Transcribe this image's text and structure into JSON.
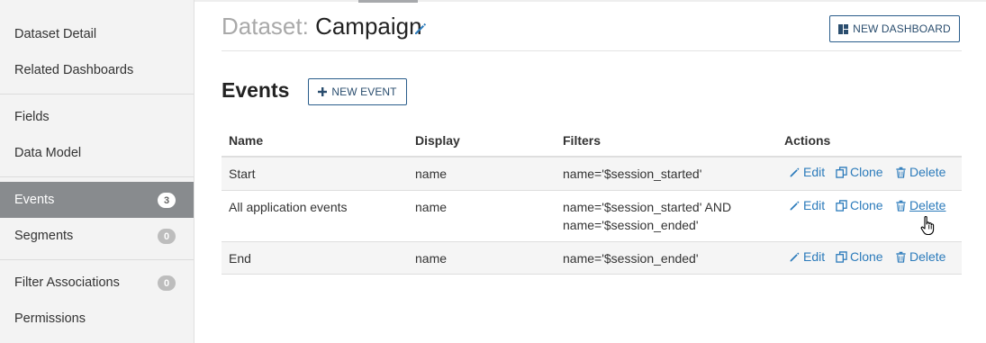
{
  "sidebar": {
    "items": [
      {
        "label": "Dataset Detail"
      },
      {
        "label": "Related Dashboards"
      },
      {
        "label": "Fields"
      },
      {
        "label": "Data Model"
      },
      {
        "label": "Events",
        "count": "3",
        "active": true
      },
      {
        "label": "Segments",
        "count": "0"
      },
      {
        "label": "Filter Associations",
        "count": "0"
      },
      {
        "label": "Permissions"
      }
    ]
  },
  "header": {
    "title_prefix": "Dataset:",
    "title_name": "Campaign",
    "new_dashboard_label": "NEW DASHBOARD"
  },
  "events": {
    "section_title": "Events",
    "new_event_label": "NEW EVENT",
    "columns": [
      "Name",
      "Display",
      "Filters",
      "Actions"
    ],
    "rows": [
      {
        "name": "Start",
        "display": "name",
        "filters": [
          "name='$session_started'"
        ]
      },
      {
        "name": "All application events",
        "display": "name",
        "filters": [
          "name='$session_started' AND",
          "name='$session_ended'"
        ]
      },
      {
        "name": "End",
        "display": "name",
        "filters": [
          "name='$session_ended'"
        ]
      }
    ],
    "actions": {
      "edit": "Edit",
      "clone": "Clone",
      "delete": "Delete"
    }
  },
  "colors": {
    "accent": "#2c7bbb",
    "sidebar_active": "#888b8e",
    "button_border": "#2a5d8b"
  },
  "icons": [
    "pencil-icon",
    "dashboard-icon",
    "plus-icon",
    "edit-icon",
    "clone-icon",
    "trash-icon",
    "hand-cursor-icon"
  ]
}
